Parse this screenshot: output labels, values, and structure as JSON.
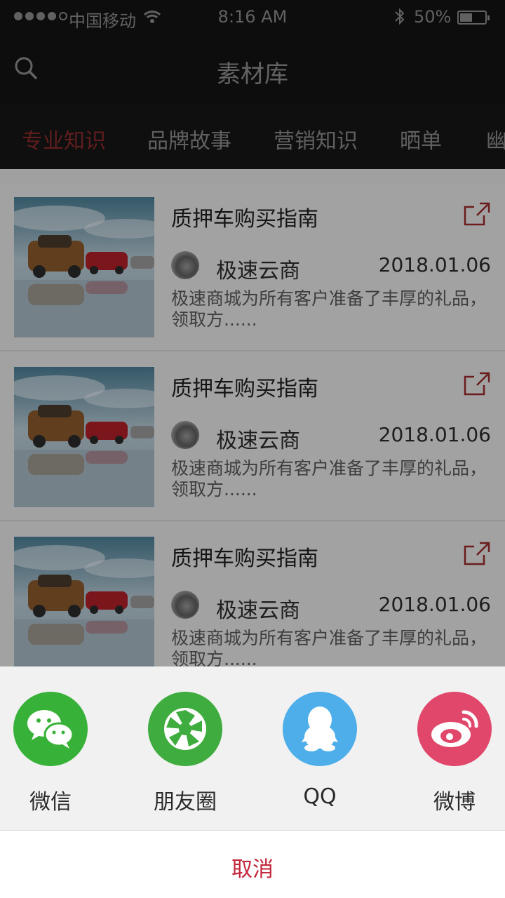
{
  "status_bar": {
    "carrier": "中国移动",
    "time": "8:16 AM",
    "battery_percent": "50%",
    "battery_level": 0.5,
    "signal_bars_filled": 4
  },
  "nav": {
    "title": "素材库",
    "search_icon": "search-icon"
  },
  "tabs": [
    {
      "label": "专业知识",
      "active": true
    },
    {
      "label": "品牌故事",
      "active": false
    },
    {
      "label": "营销知识",
      "active": false
    },
    {
      "label": "晒单",
      "active": false
    },
    {
      "label": "幽",
      "active": false
    }
  ],
  "articles": [
    {
      "title": "质押车购买指南",
      "author": "极速云商",
      "date": "2018.01.06",
      "summary": "极速商城为所有客户准备了丰厚的礼品，领取方......"
    },
    {
      "title": "质押车购买指南",
      "author": "极速云商",
      "date": "2018.01.06",
      "summary": "极速商城为所有客户准备了丰厚的礼品，领取方......"
    },
    {
      "title": "质押车购买指南",
      "author": "极速云商",
      "date": "2018.01.06",
      "summary": "极速商城为所有客户准备了丰厚的礼品，领取方......"
    }
  ],
  "share_sheet": {
    "targets": [
      {
        "label": "微信",
        "icon": "wechat-icon",
        "color": "#38b138"
      },
      {
        "label": "朋友圈",
        "icon": "moments-icon",
        "color": "#3eac3e"
      },
      {
        "label": "QQ",
        "icon": "qq-icon",
        "color": "#4eaeea"
      },
      {
        "label": "微博",
        "icon": "weibo-icon",
        "color": "#e1476b"
      }
    ],
    "cancel_label": "取消"
  },
  "colors": {
    "accent": "#c3253a",
    "active_tab": "#8a2a2a",
    "header_bg": "#141414"
  }
}
